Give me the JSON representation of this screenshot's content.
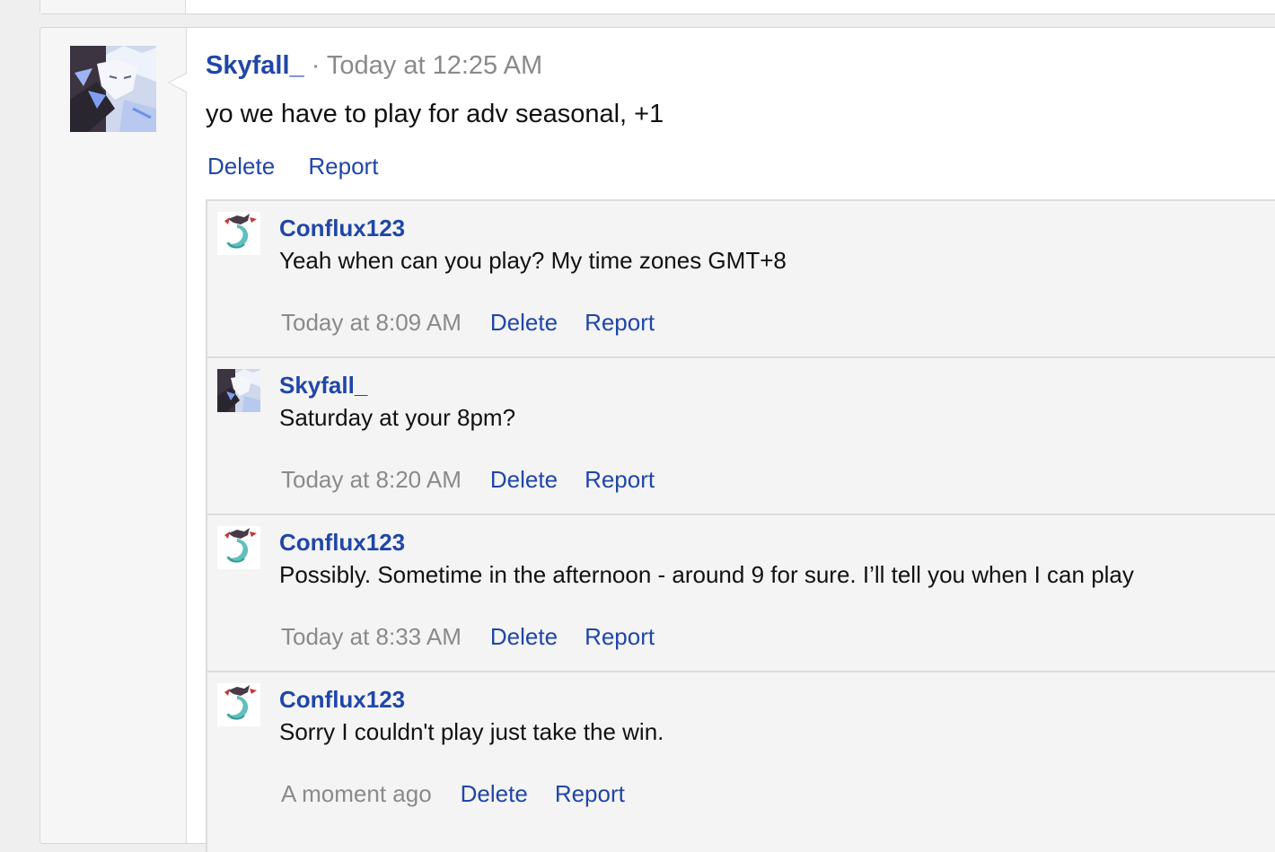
{
  "post": {
    "author": "Skyfall_",
    "separator": "·",
    "time": "Today at 12:25 AM",
    "body": "yo we have to play for adv seasonal, +1",
    "actions": {
      "delete": "Delete",
      "report": "Report"
    }
  },
  "comments": [
    {
      "author": "Conflux123",
      "text": "Yeah when can you play? My time zones GMT+8",
      "time": "Today at 8:09 AM",
      "delete": "Delete",
      "report": "Report",
      "avatar_icon": "mermaid-avatar-icon"
    },
    {
      "author": "Skyfall_",
      "text": "Saturday at your 8pm?",
      "time": "Today at 8:20 AM",
      "delete": "Delete",
      "report": "Report",
      "avatar_icon": "anime-avatar-icon"
    },
    {
      "author": "Conflux123",
      "text": "Possibly. Sometime in the afternoon - around 9 for sure. I’ll tell you when I can play",
      "time": "Today at 8:33 AM",
      "delete": "Delete",
      "report": "Report",
      "avatar_icon": "mermaid-avatar-icon"
    },
    {
      "author": "Conflux123",
      "text": "Sorry I couldn't play just take the win.",
      "time": "A moment ago",
      "delete": "Delete",
      "report": "Report",
      "avatar_icon": "mermaid-avatar-icon"
    }
  ],
  "colors": {
    "link": "#2046a8",
    "muted": "#8a8a8a",
    "comment_bg": "#f4f4f4",
    "page_bg": "#efefef"
  }
}
